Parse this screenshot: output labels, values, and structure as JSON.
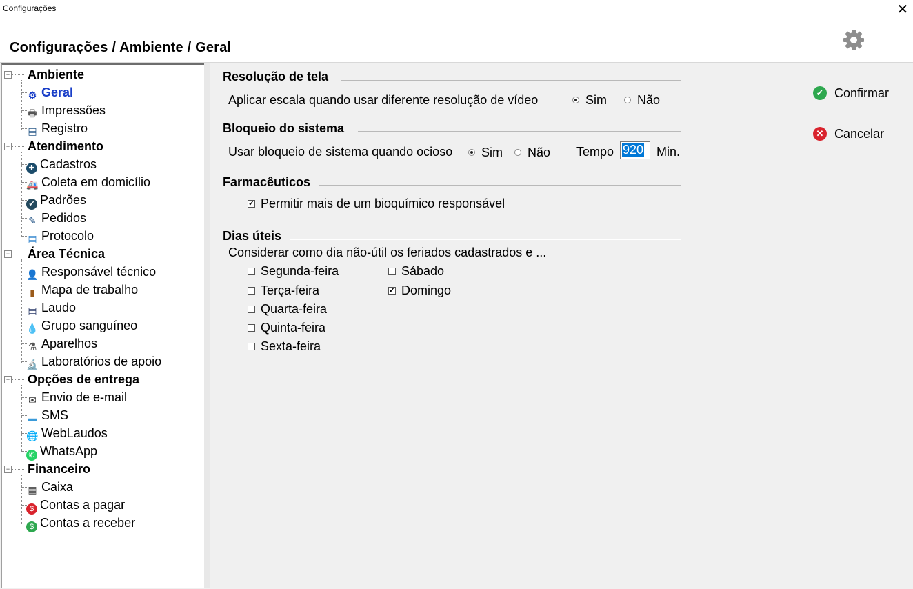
{
  "window": {
    "title": "Configurações",
    "breadcrumb": "Configurações / Ambiente / Geral"
  },
  "sidebar": {
    "categories": [
      {
        "label": "Ambiente",
        "items": [
          {
            "label": "Geral",
            "icon": "gear-icon",
            "selected": true
          },
          {
            "label": "Impressões",
            "icon": "printer-icon"
          },
          {
            "label": "Registro",
            "icon": "document-icon"
          }
        ]
      },
      {
        "label": "Atendimento",
        "items": [
          {
            "label": "Cadastros",
            "icon": "plus-circle-icon"
          },
          {
            "label": "Coleta em domicílio",
            "icon": "ambulance-icon"
          },
          {
            "label": "Padrões",
            "icon": "check-circle-icon"
          },
          {
            "label": "Pedidos",
            "icon": "edit-document-icon"
          },
          {
            "label": "Protocolo",
            "icon": "file-icon"
          }
        ]
      },
      {
        "label": "Área Técnica",
        "items": [
          {
            "label": "Responsável técnico",
            "icon": "user-icon"
          },
          {
            "label": "Mapa de trabalho",
            "icon": "book-icon"
          },
          {
            "label": "Laudo",
            "icon": "report-icon"
          },
          {
            "label": "Grupo sanguíneo",
            "icon": "blood-drop-icon"
          },
          {
            "label": "Aparelhos",
            "icon": "device-icon"
          },
          {
            "label": "Laboratórios de apoio",
            "icon": "microscope-icon"
          }
        ]
      },
      {
        "label": "Opções de entrega",
        "items": [
          {
            "label": "Envio de e-mail",
            "icon": "envelope-icon"
          },
          {
            "label": "SMS",
            "icon": "sms-icon"
          },
          {
            "label": "WebLaudos",
            "icon": "globe-icon"
          },
          {
            "label": "WhatsApp",
            "icon": "whatsapp-icon"
          }
        ]
      },
      {
        "label": "Financeiro",
        "items": [
          {
            "label": "Caixa",
            "icon": "cash-register-icon"
          },
          {
            "label": "Contas a pagar",
            "icon": "dollar-red-icon"
          },
          {
            "label": "Contas a receber",
            "icon": "dollar-green-icon"
          }
        ]
      }
    ]
  },
  "main": {
    "resolucao": {
      "title": "Resolução de tela",
      "label": "Aplicar escala quando usar diferente resolução de vídeo",
      "opt_yes": "Sim",
      "opt_no": "Não",
      "selected": "Sim"
    },
    "bloqueio": {
      "title": "Bloqueio do sistema",
      "label": "Usar bloqueio de sistema quando ocioso",
      "opt_yes": "Sim",
      "opt_no": "Não",
      "selected": "Sim",
      "tempo_label": "Tempo",
      "tempo_value": "920",
      "unit": "Min."
    },
    "farmaceuticos": {
      "title": "Farmacêuticos",
      "checkbox_label": "Permitir mais de um bioquímico responsável",
      "checked": true
    },
    "dias_uteis": {
      "title": "Dias úteis",
      "label": "Considerar como dia não-útil os feriados cadastrados e ...",
      "days": [
        {
          "label": "Segunda-feira",
          "checked": false
        },
        {
          "label": "Terça-feira",
          "checked": false
        },
        {
          "label": "Quarta-feira",
          "checked": false
        },
        {
          "label": "Quinta-feira",
          "checked": false
        },
        {
          "label": "Sexta-feira",
          "checked": false
        },
        {
          "label": "Sábado",
          "checked": false
        },
        {
          "label": "Domingo",
          "checked": true
        }
      ]
    }
  },
  "actions": {
    "confirm": {
      "label": "Confirmar",
      "color": "#2ea84f"
    },
    "cancel": {
      "label": "Cancelar",
      "color": "#d9232d"
    }
  },
  "colors": {
    "selected_item": "#1a3fc8",
    "input_selection": "#0078d7"
  }
}
